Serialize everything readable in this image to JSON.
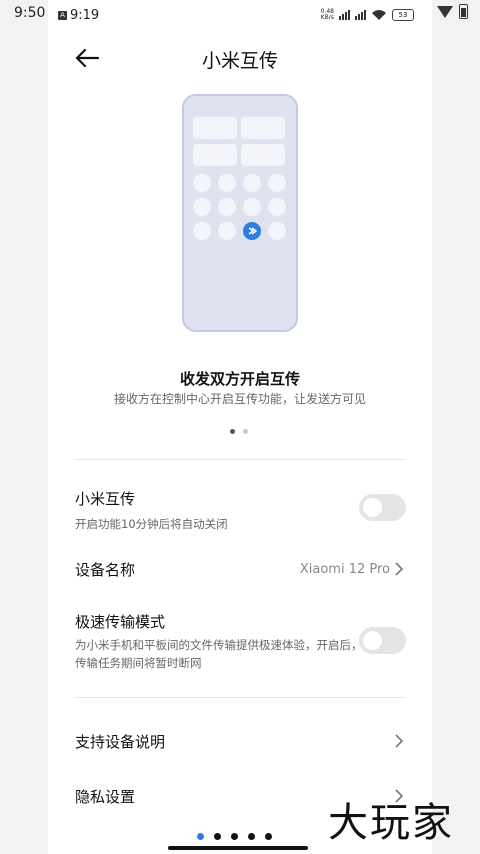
{
  "outer_status": {
    "time": "9:50"
  },
  "inner_status": {
    "time": "9:19",
    "net_speed_top": "0.48",
    "net_speed_bottom": "KB/s",
    "battery": "53"
  },
  "header": {
    "title": "小米互传"
  },
  "illustration": {
    "caption_title": "收发双方开启互传",
    "caption_subtitle": "接收方在控制中心开启互传功能，让发送方可见"
  },
  "settings": {
    "mi_share": {
      "title": "小米互传",
      "subtitle": "开启功能10分钟后将自动关闭",
      "enabled": false
    },
    "device_name": {
      "title": "设备名称",
      "value": "Xiaomi 12 Pro"
    },
    "fast_transfer": {
      "title": "极速传输模式",
      "subtitle": "为小米手机和平板间的文件传输提供极速体验，开启后，传输任务期间将暂时断网",
      "enabled": false
    },
    "supported_devices": {
      "title": "支持设备说明"
    },
    "privacy": {
      "title": "隐私设置"
    }
  },
  "watermark": "大玩家",
  "colors": {
    "accent": "#2f7de1",
    "toggle_off": "#e4e4e4"
  }
}
